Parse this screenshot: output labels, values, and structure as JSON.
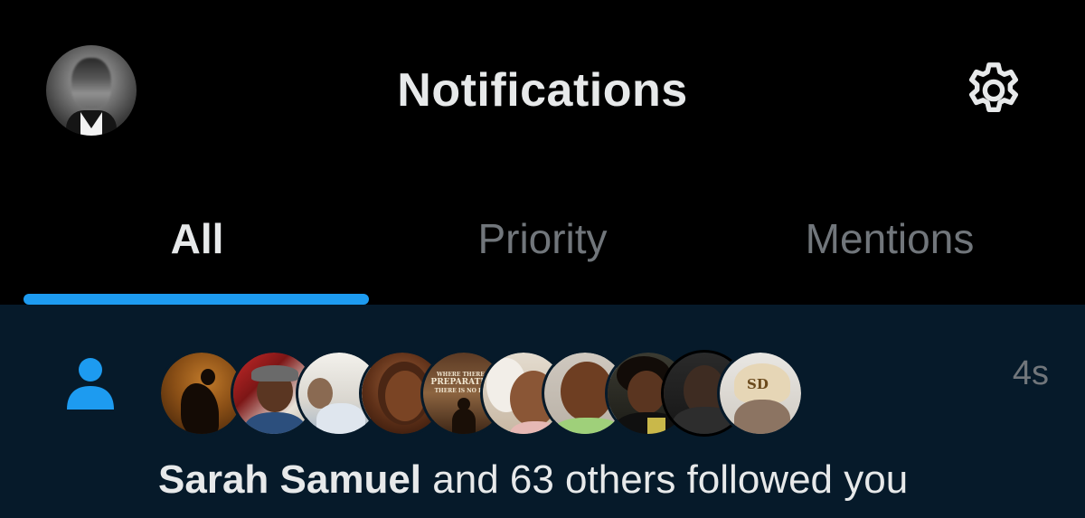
{
  "header": {
    "title": "Notifications",
    "settings_icon": "gear-icon"
  },
  "tabs": [
    {
      "label": "All",
      "active": true
    },
    {
      "label": "Priority",
      "active": false
    },
    {
      "label": "Mentions",
      "active": false
    }
  ],
  "notification": {
    "type_icon": "person-icon",
    "timestamp": "4s",
    "actor_name": "Sarah Samuel",
    "action_text": " and 63 others followed you",
    "follower_avatar_count": 10,
    "poster_text": [
      "WHERE THERE IS",
      "PREPARATION",
      "THERE IS NO FEAR"
    ],
    "cap_logo": "SD"
  },
  "colors": {
    "background": "#000000",
    "notification_background": "#061a2a",
    "accent": "#1d9bf0",
    "primary_text": "#e7e9ea",
    "secondary_text": "#71767b"
  }
}
